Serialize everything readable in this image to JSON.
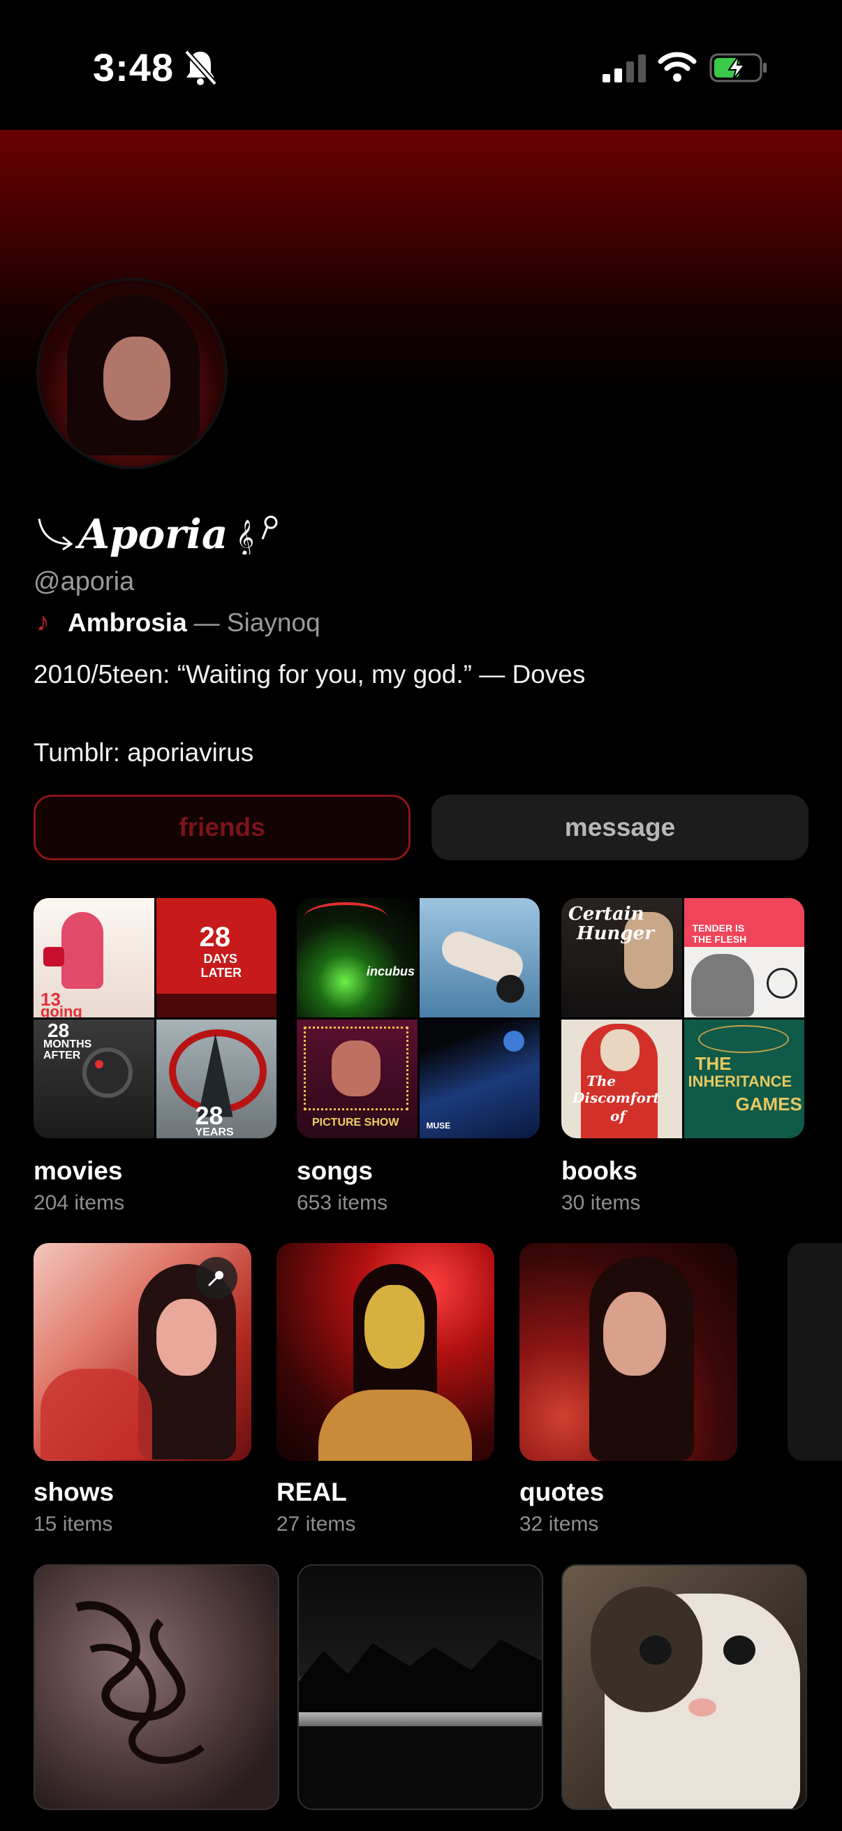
{
  "status_bar": {
    "time": "3:48"
  },
  "profile": {
    "display_name": "Aporia",
    "handle": "@aporia",
    "now_playing": {
      "title": "Ambrosia",
      "artist": "— Siaynoq"
    },
    "bio_lines": [
      "2010/5teen: “Waiting for you, my god.” — Doves",
      "Tumblr: aporiavirus"
    ]
  },
  "actions": {
    "friends_label": "friends",
    "message_label": "message"
  },
  "collections": [
    {
      "title": "movies",
      "count": "204 items"
    },
    {
      "title": "songs",
      "count": "653 items"
    },
    {
      "title": "books",
      "count": "30 items"
    },
    {
      "title": "shows",
      "count": "15 items"
    },
    {
      "title": "REAL",
      "count": "27 items"
    },
    {
      "title": "quotes",
      "count": "32 items"
    }
  ],
  "poster_text": {
    "movie_28_days": [
      "28",
      "DAYS",
      "LATER"
    ],
    "movie_13_going": [
      "13",
      "going"
    ],
    "movie_28_months": [
      "28",
      "MONTHS",
      "AFTER"
    ],
    "movie_28_years": [
      "28",
      "YEARS"
    ],
    "song_incubus": "incubus",
    "song_picture_show": "PICTURE SHOW",
    "song_muse": "MUSE",
    "book_certain_hunger": [
      "Certain",
      "Hunger"
    ],
    "book_tender": [
      "TENDER IS",
      "THE FLESH"
    ],
    "book_discomfort": [
      "The",
      "Discomfort",
      "of"
    ],
    "book_inheritance": [
      "THE",
      "INHERITANCE",
      "GAMES"
    ]
  },
  "colors": {
    "accent": "#8a1518",
    "header_red": "#6a0000",
    "muted": "#8f8f8f"
  },
  "icons": [
    "bell-slash-icon",
    "cellular-signal-icon",
    "wifi-icon",
    "battery-charging-icon",
    "music-note-icon",
    "pin-icon"
  ]
}
